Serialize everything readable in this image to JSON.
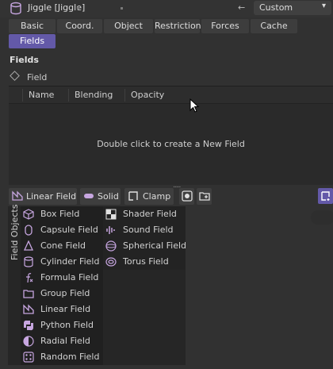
{
  "header": {
    "title": "Jiggle [Jiggle]",
    "arrow": "←",
    "preset": "Custom",
    "preset_caret": "▾"
  },
  "tabs": [
    {
      "label": "Basic"
    },
    {
      "label": "Coord."
    },
    {
      "label": "Object"
    },
    {
      "label": "Restriction"
    },
    {
      "label": "Forces"
    },
    {
      "label": "Cache"
    },
    {
      "label": "Fields"
    }
  ],
  "section": {
    "title": "Fields",
    "field_label": "Field"
  },
  "list": {
    "columns": [
      "Name",
      "Blending",
      "Opacity"
    ],
    "empty_message": "Double click to create a New Field",
    "grip": "....."
  },
  "toolbar": {
    "linear_field": "Linear Field",
    "solid": "Solid",
    "clamp": "Clamp"
  },
  "popup": {
    "side_label": "Field Objects",
    "col1": [
      {
        "label": "Box Field",
        "icon": "box-field-icon"
      },
      {
        "label": "Capsule Field",
        "icon": "capsule-field-icon"
      },
      {
        "label": "Cone Field",
        "icon": "cone-field-icon"
      },
      {
        "label": "Cylinder Field",
        "icon": "cylinder-field-icon"
      },
      {
        "label": "Formula Field",
        "icon": "formula-field-icon"
      },
      {
        "label": "Group Field",
        "icon": "group-field-icon"
      },
      {
        "label": "Linear Field",
        "icon": "linear-field-icon"
      },
      {
        "label": "Python Field",
        "icon": "python-field-icon"
      },
      {
        "label": "Radial Field",
        "icon": "radial-field-icon"
      },
      {
        "label": "Random Field",
        "icon": "random-field-icon"
      }
    ],
    "col2": [
      {
        "label": "Shader Field",
        "icon": "shader-field-icon"
      },
      {
        "label": "Sound Field",
        "icon": "sound-field-icon"
      },
      {
        "label": "Spherical Field",
        "icon": "spherical-field-icon"
      },
      {
        "label": "Torus Field",
        "icon": "torus-field-icon"
      }
    ]
  },
  "colors": {
    "accent": "#6359a8",
    "background": "#313131",
    "icon": "#c7a6e0"
  }
}
